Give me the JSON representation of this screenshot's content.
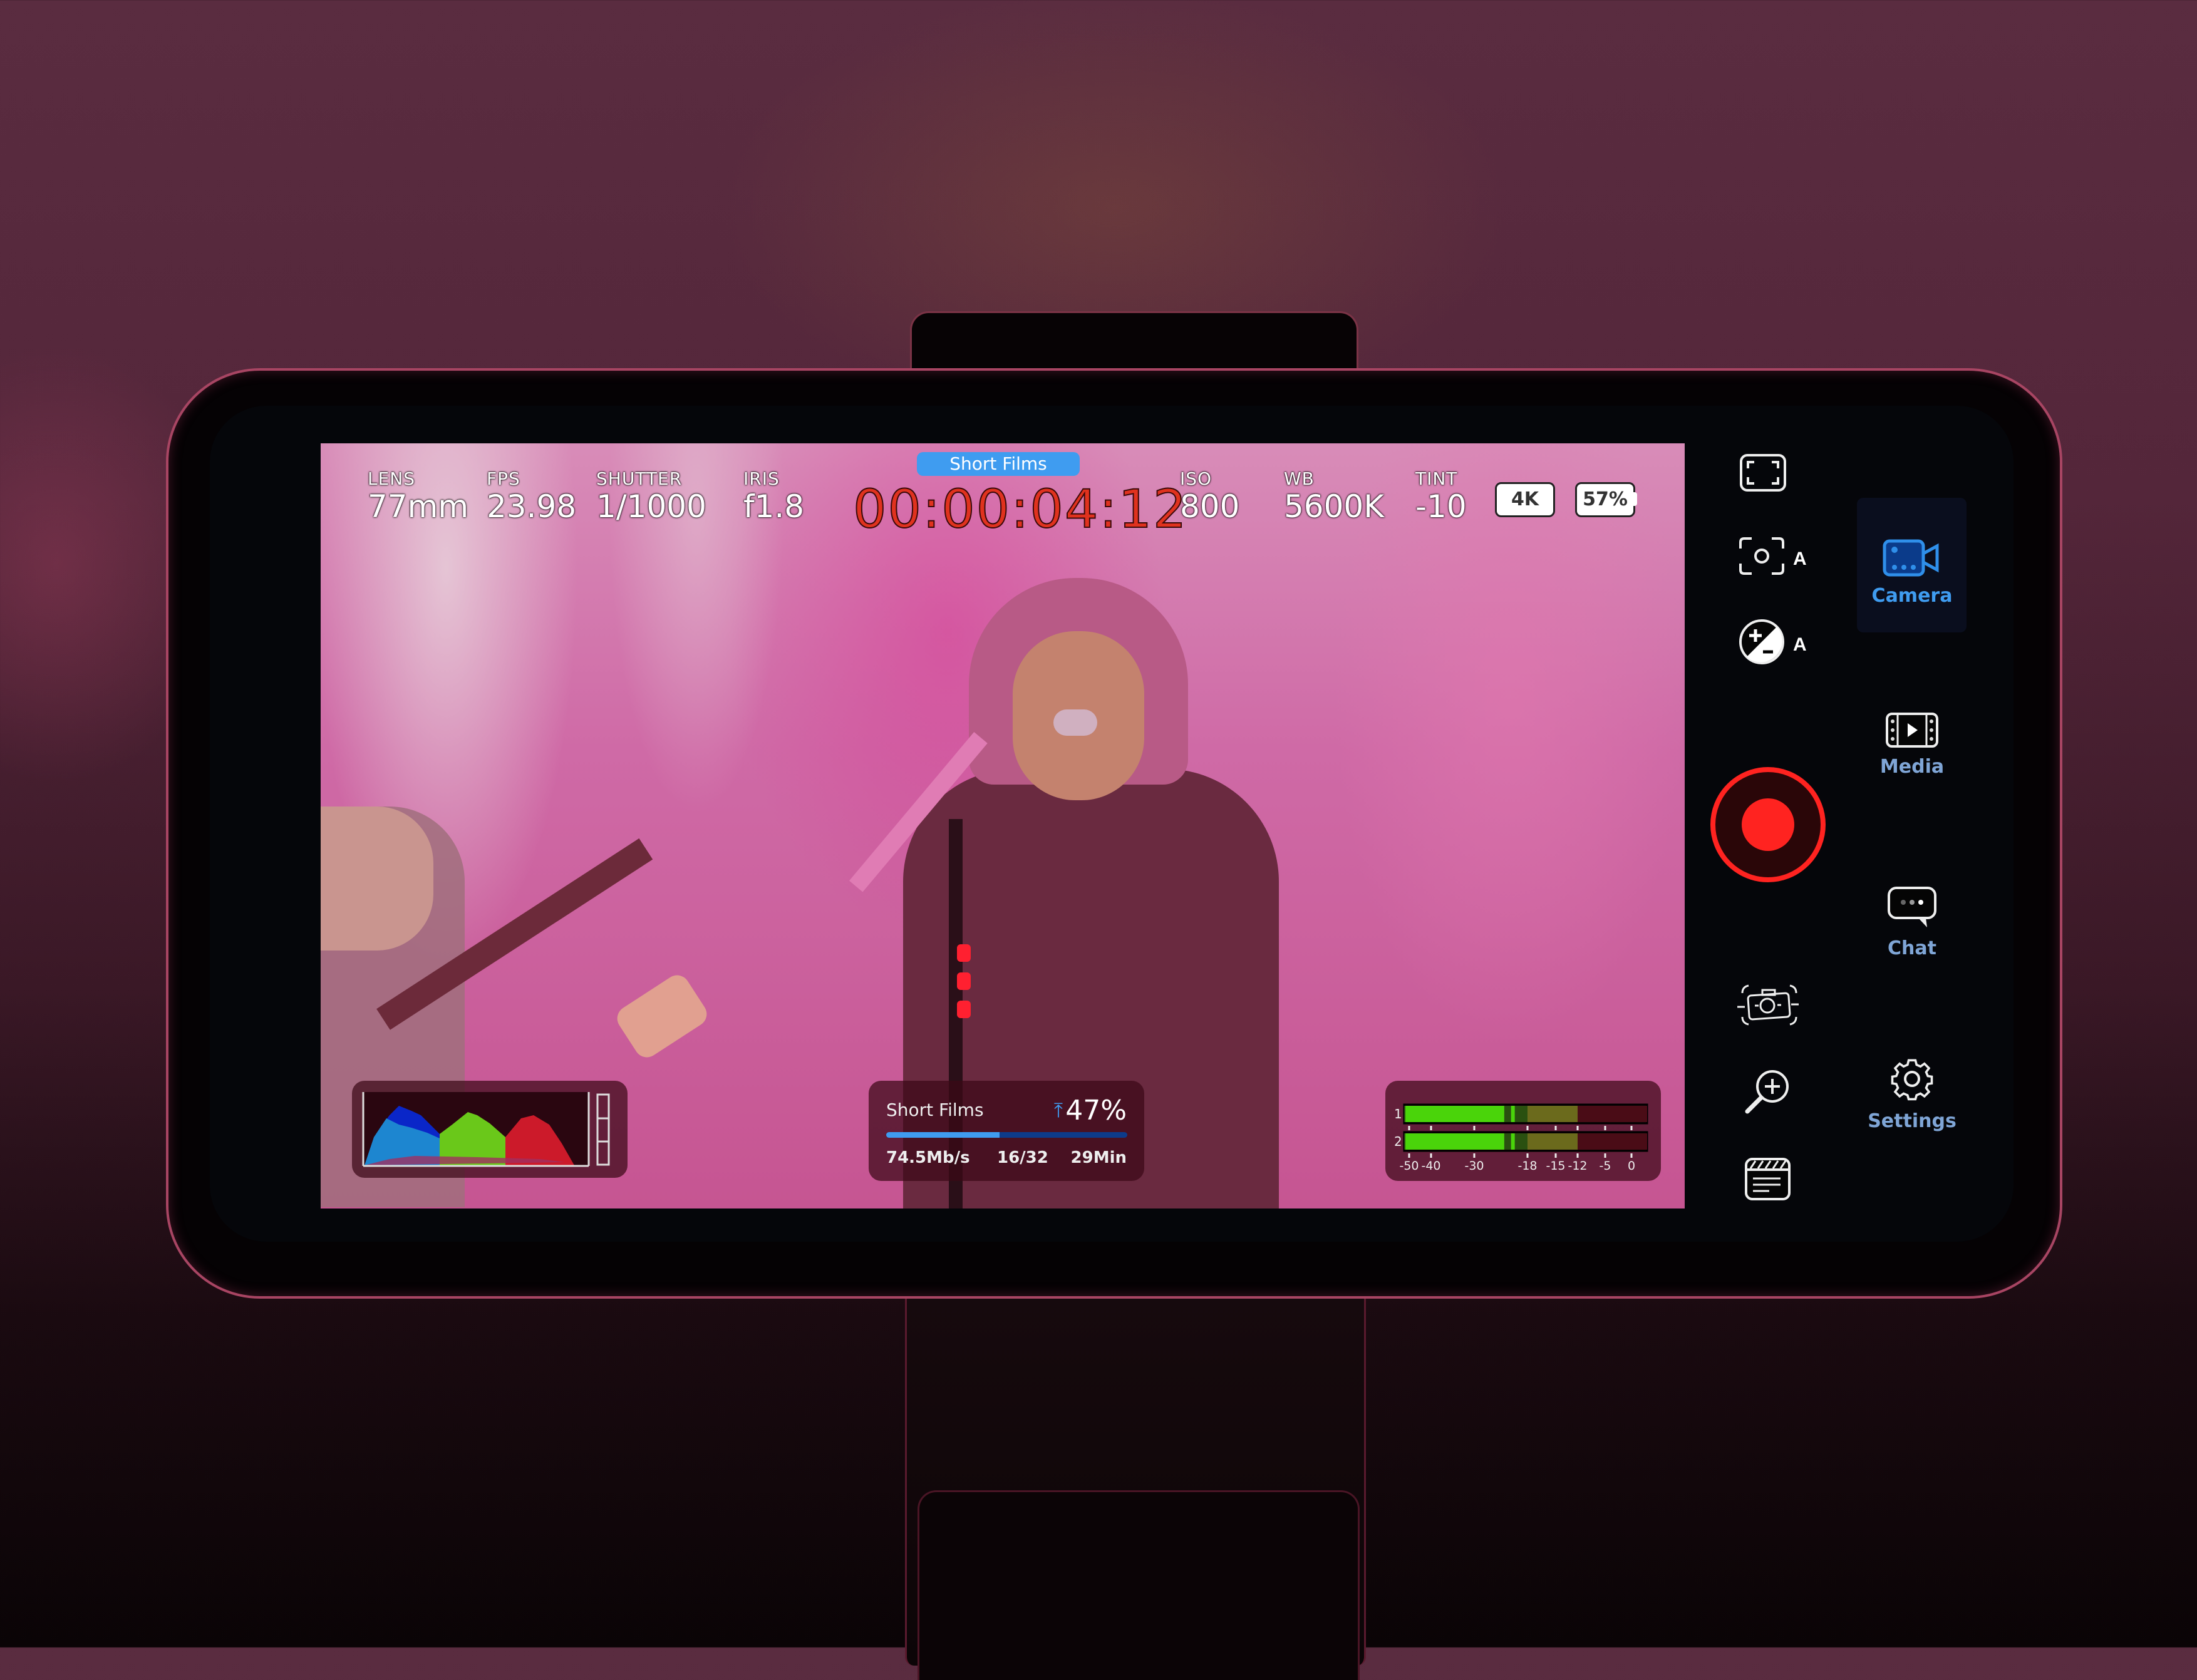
{
  "hud": {
    "project_tag": "Short Films",
    "timecode": "00:00:04:12",
    "params": [
      {
        "label": "LENS",
        "value": "77mm"
      },
      {
        "label": "FPS",
        "value": "23.98"
      },
      {
        "label": "SHUTTER",
        "value": "1/1000"
      },
      {
        "label": "IRIS",
        "value": "f1.8"
      },
      {
        "label": "ISO",
        "value": "800"
      },
      {
        "label": "WB",
        "value": "5600K"
      },
      {
        "label": "TINT",
        "value": "-10"
      }
    ],
    "resolution_badge": "4K",
    "battery": "57%"
  },
  "clip_panel": {
    "project": "Short Films",
    "upload_icon": "upload-arrow-icon",
    "upload_percent": "47%",
    "upload_progress": 0.47,
    "bitrate": "74.5Mb/s",
    "clip_count": "16/32",
    "remaining": "29Min"
  },
  "audio_meter": {
    "channels": [
      "1",
      "2"
    ],
    "scale": [
      "-50",
      "-40",
      "-30",
      "-18",
      "-15",
      "-12",
      "-5",
      "0"
    ],
    "levels_db": [
      -20,
      -20
    ],
    "peak_db": [
      -22,
      -22
    ]
  },
  "histogram": {
    "channels": [
      "red",
      "green",
      "blue",
      "luma"
    ]
  },
  "controls": {
    "left_column": [
      {
        "icon": "frame-guides-icon"
      },
      {
        "icon": "auto-focus-icon",
        "suffix": "A"
      },
      {
        "icon": "auto-exposure-icon",
        "suffix": "A"
      },
      {
        "icon": "record-button"
      },
      {
        "icon": "camera-stabilization-icon"
      },
      {
        "icon": "zoom-in-icon"
      },
      {
        "icon": "slate-icon"
      }
    ],
    "nav": [
      {
        "label": "Camera",
        "icon": "video-camera-icon",
        "active": true
      },
      {
        "label": "Media",
        "icon": "film-play-icon",
        "active": false
      },
      {
        "label": "Chat",
        "icon": "chat-bubble-icon",
        "active": false
      },
      {
        "label": "Settings",
        "icon": "gear-icon",
        "active": false
      }
    ]
  },
  "colors": {
    "accent_blue": "#3f9cf0",
    "record_red": "#ff2320",
    "timecode_red": "#e0321e",
    "nav_label": "#7fa5d6"
  }
}
